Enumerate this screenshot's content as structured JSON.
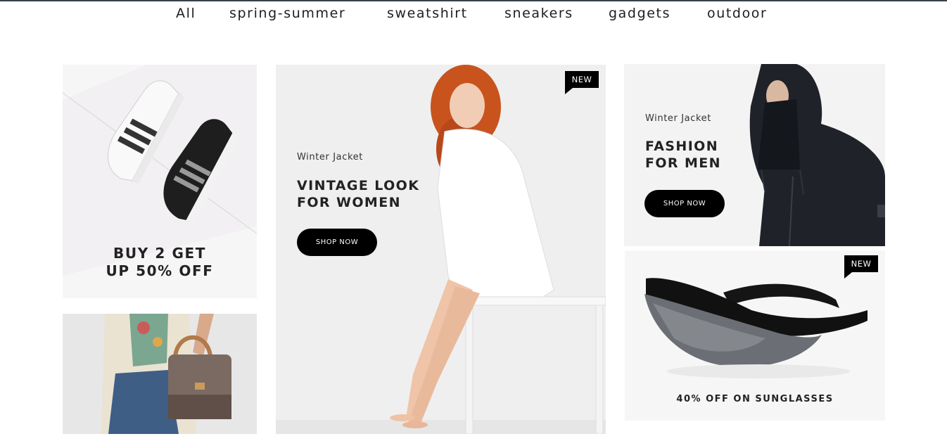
{
  "tabs": [
    "All",
    "spring-summer",
    "sweatshirt",
    "sneakers",
    "gadgets",
    "outdoor"
  ],
  "banners": {
    "sneakers": {
      "title_line1": "BUY 2 GET",
      "title_line2": "UP 50% OFF"
    },
    "women": {
      "subtitle": "Winter Jacket",
      "title_line1": "VINTAGE LOOK",
      "title_line2": "FOR WOMEN",
      "button": "SHOP NOW",
      "badge": "NEW"
    },
    "men": {
      "subtitle": "Winter Jacket",
      "title_line1": "FASHION",
      "title_line2": "FOR MEN",
      "button": "SHOP NOW"
    },
    "sunglasses": {
      "title": "40% OFF ON SUNGLASSES",
      "badge": "NEW"
    }
  }
}
